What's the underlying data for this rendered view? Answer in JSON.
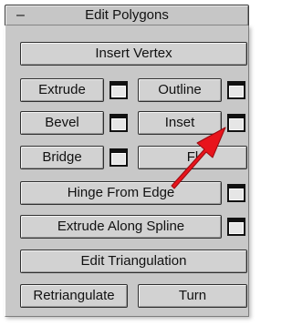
{
  "rollout": {
    "toggle": "–",
    "title": "Edit Polygons"
  },
  "buttons": {
    "insert_vertex": "Insert Vertex",
    "extrude": "Extrude",
    "outline": "Outline",
    "bevel": "Bevel",
    "inset": "Inset",
    "bridge": "Bridge",
    "flip": "Fl",
    "hinge_from_edge": "Hinge From Edge",
    "extrude_along_spline": "Extrude Along Spline",
    "edit_triangulation": "Edit Triangulation",
    "retriangulate": "Retriangulate",
    "turn": "Turn"
  },
  "icons": {
    "settings": "settings-box-icon",
    "annotation": "red-arrow-icon"
  },
  "colors": {
    "panel": "#c8c8c8",
    "button": "#d2d2d2",
    "annotation_arrow": "#e8141c"
  }
}
